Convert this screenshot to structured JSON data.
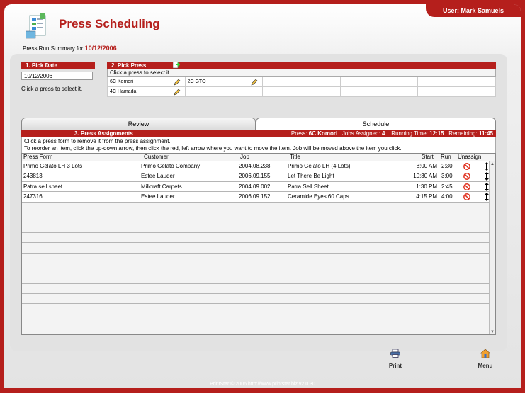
{
  "header": {
    "user_label": "User: Mark Samuels",
    "app_title": "Press Scheduling",
    "summary_label": "Press Run Summary for",
    "summary_date": "10/12/2006"
  },
  "pick_date": {
    "heading": "1. Pick Date",
    "value": "10/12/2006",
    "hint": "Click a press to select it."
  },
  "pick_press": {
    "heading": "2. Pick Press",
    "hint": "Click a press to select it.",
    "presses": [
      "6C Komori",
      "2C GTO",
      "",
      "",
      "",
      "4C Hamada",
      "",
      "",
      "",
      ""
    ]
  },
  "tabs": {
    "review": "Review",
    "schedule": "Schedule"
  },
  "assignments": {
    "heading": "3. Press Assignments",
    "press_label": "Press:",
    "press_value": "6C Komori",
    "jobs_label": "Jobs Assigned:",
    "jobs_value": "4",
    "running_label": "Running Time:",
    "running_value": "12:15",
    "remaining_label": "Remaining:",
    "remaining_value": "11:45",
    "instruction_1": "Click a press form to remove it from the press assignment.",
    "instruction_2": "To reorder an item, click the up-down arrow, then click the red, left arrow where you want to move the item. Job will be moved above the item you click.",
    "columns": {
      "press_form": "Press Form",
      "customer": "Customer",
      "job": "Job",
      "title": "Title",
      "start": "Start",
      "run": "Run",
      "unassign": "Unassign"
    },
    "rows": [
      {
        "press_form": "Primo Gelato LH 3 Lots",
        "customer": "Primo Gelato Company",
        "job": "2004.08.238",
        "title": "Primo Gelato LH (4 Lots)",
        "start": "8:00 AM",
        "run": "2:30"
      },
      {
        "press_form": "243813",
        "customer": "Estee Lauder",
        "job": "2006.09.155",
        "title": "Let There Be Light",
        "start": "10:30 AM",
        "run": "3:00"
      },
      {
        "press_form": "Patra sell sheet",
        "customer": "Millcraft Carpets",
        "job": "2004.09.002",
        "title": "Patra Sell Sheet",
        "start": "1:30 PM",
        "run": "2:45"
      },
      {
        "press_form": "247316",
        "customer": "Estee Lauder",
        "job": "2006.09.152",
        "title": "Ceramide Eyes 60 Caps",
        "start": "4:15 PM",
        "run": "4:00"
      }
    ]
  },
  "buttons": {
    "print": "Print",
    "menu": "Menu"
  },
  "footer": "PrintStar © 2006 http://www.printstar.biz v2.0.30",
  "colors": {
    "brand_red": "#b51f1c",
    "panel_gray": "#e2e2e2"
  }
}
